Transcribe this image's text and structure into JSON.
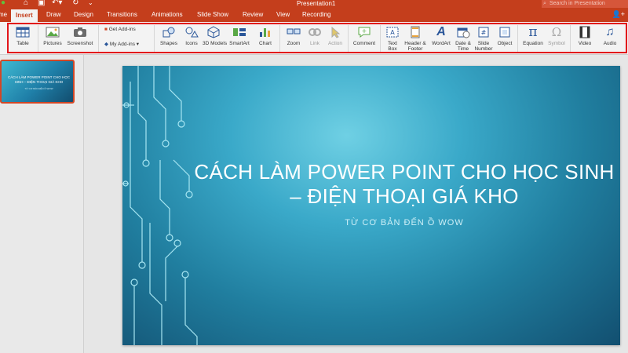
{
  "window": {
    "title": "Presentation1"
  },
  "search": {
    "placeholder": "Search in Presentation"
  },
  "tabs": [
    {
      "label": "me"
    },
    {
      "label": "Insert"
    },
    {
      "label": "Draw"
    },
    {
      "label": "Design"
    },
    {
      "label": "Transitions"
    },
    {
      "label": "Animations"
    },
    {
      "label": "Slide Show"
    },
    {
      "label": "Review"
    },
    {
      "label": "View"
    },
    {
      "label": "Recording"
    }
  ],
  "ribbon": {
    "table": "Table",
    "pictures": "Pictures",
    "screenshot": "Screenshot",
    "get_addins": "Get Add-ins",
    "my_addins": "My Add-ins",
    "shapes": "Shapes",
    "icons": "Icons",
    "models_3d": "3D Models",
    "smartart": "SmartArt",
    "chart": "Chart",
    "zoom": "Zoom",
    "link": "Link",
    "action": "Action",
    "comment": "Comment",
    "text_box": "Text Box",
    "header_footer": "Header & Footer",
    "wordart": "WordArt",
    "date_time": "Date & Time",
    "slide_number": "Slide Number",
    "object": "Object",
    "equation": "Equation",
    "symbol": "Symbol",
    "video": "Video",
    "audio": "Audio"
  },
  "slide": {
    "title": "CÁCH LÀM POWER POINT CHO HỌC SINH – ĐIỆN THOẠI GIÁ KHO",
    "subtitle": "TỪ CƠ BẢN ĐẾN Ồ WOW"
  },
  "colors": {
    "accent": "#c43e1c",
    "highlight": "#e2161b"
  }
}
